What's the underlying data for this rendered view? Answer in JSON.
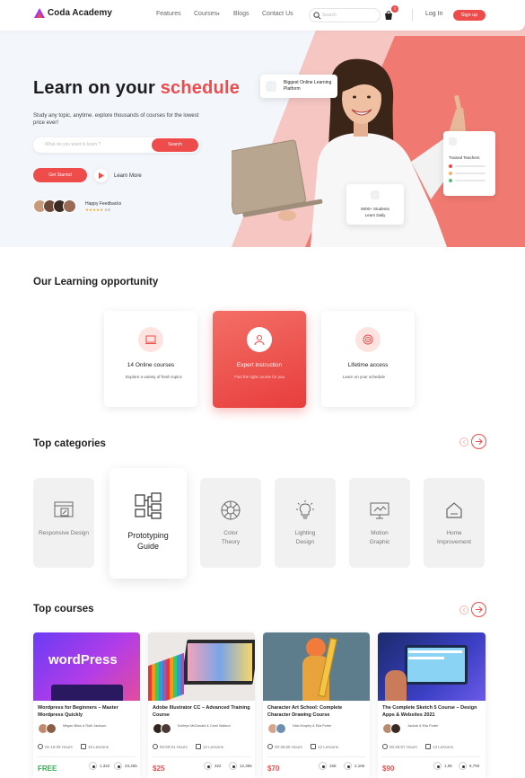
{
  "header": {
    "brand": "Coda Academy",
    "nav": [
      "Features",
      "Courses",
      "Blogs",
      "Contact Us"
    ],
    "courses_caret": "▾",
    "search_placeholder": "Search",
    "cart_count": "1",
    "login": "Log In",
    "signup": "Sign up"
  },
  "hero": {
    "title_part1": "Learn on your ",
    "title_highlight": "schedule",
    "subtitle": "Study any topic, anytime. explore thousands of courses for the lowest price ever!",
    "search_placeholder": "What do you want to learn ?",
    "search_button": "Search",
    "get_started": "Get Started",
    "learn_more": "Learn More",
    "feedback_label": "Happy Feedbacks",
    "feedback_stars": "★★★★★",
    "feedback_rating": "4.8",
    "card_platform": "Biggest Online Learning Platform",
    "card_students": "5000+ Students Learn Daily",
    "card_teachers": "Trained Teachers"
  },
  "learning": {
    "title": "Our Learning opportunity",
    "cards": [
      {
        "label": "14 Online courses",
        "desc": "Explore a variety of fresh topics"
      },
      {
        "label": "Expert instruction",
        "desc": "Find the right course for you"
      },
      {
        "label": "Lifetime access",
        "desc": "Learn on your schedule"
      }
    ]
  },
  "categories": {
    "title": "Top categories",
    "items": [
      {
        "label": "Responsive Design"
      },
      {
        "label": "Prototyping Guide"
      },
      {
        "label": "Color Theory"
      },
      {
        "label": "Lighting Design"
      },
      {
        "label": "Motion Graphic"
      },
      {
        "label": "Home Improvement"
      }
    ]
  },
  "courses": {
    "title": "Top courses",
    "items": [
      {
        "thumb_text": "wordPress",
        "title": "Wordpress for Beginners – Master Wordpress Quickly",
        "instructor": "Megan Bliss & Ruth Jackson",
        "hours": "01:15:09 Hours",
        "lessons": "15 Lessons",
        "price": "FREE",
        "rating": "1,322",
        "students": "23,455"
      },
      {
        "thumb_text": "",
        "title": "Adobe Illustrator CC – Advanced Training Course",
        "instructor": "Kathryn McDonald & Carol Watson",
        "hours": "00:50:01 Hours",
        "lessons": "12 Lessons",
        "price": "$25",
        "rating": "322",
        "students": "12,365"
      },
      {
        "thumb_text": "",
        "title": "Character Art School: Complete Character Drawing Course",
        "instructor": "Nick Murphy & Elia Porter",
        "hours": "00:36:55 Hours",
        "lessons": "12 Lessons",
        "price": "$70",
        "rating": "156",
        "students": "2,165"
      },
      {
        "thumb_text": "",
        "title": "The Complete Sketch 5 Course – Design Apps & Websites 2021",
        "instructor": "Jackob & Elia Porter",
        "hours": "00:45:57 Hours",
        "lessons": "13 Lessons",
        "price": "$90",
        "rating": "1,06",
        "students": "6,793"
      }
    ]
  },
  "colors": {
    "accent": "#ee4b4b",
    "free": "#2bb24c",
    "dark": "#1f1f1f"
  }
}
